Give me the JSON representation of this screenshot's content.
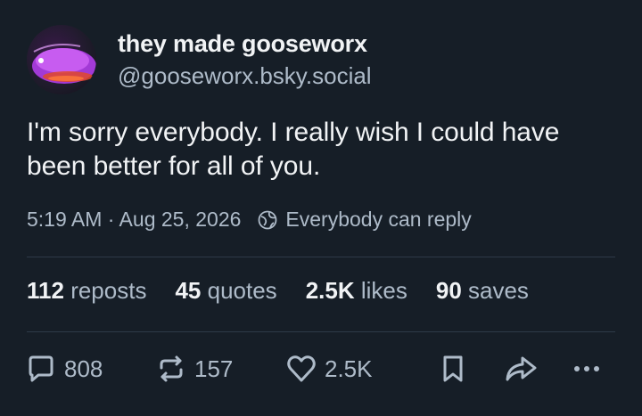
{
  "author": {
    "display_name": "they made gooseworx",
    "handle": "@gooseworx.bsky.social",
    "avatar_icon": "purple-fish-avatar"
  },
  "post": {
    "text": "I'm sorry everybody. I really wish I could have been better for all of you.",
    "timestamp": "5:19 AM · Aug 25, 2026",
    "reply_setting": "Everybody can reply"
  },
  "stats": {
    "reposts_count": "112",
    "reposts_label": "reposts",
    "quotes_count": "45",
    "quotes_label": "quotes",
    "likes_count": "2.5K",
    "likes_label": "likes",
    "saves_count": "90",
    "saves_label": "saves"
  },
  "actions": {
    "reply_count": "808",
    "repost_count": "157",
    "like_count": "2.5K"
  },
  "colors": {
    "background": "#161e27",
    "text_primary": "#f1f3f5",
    "text_secondary": "#aebbc9",
    "divider": "#2e3a48"
  }
}
